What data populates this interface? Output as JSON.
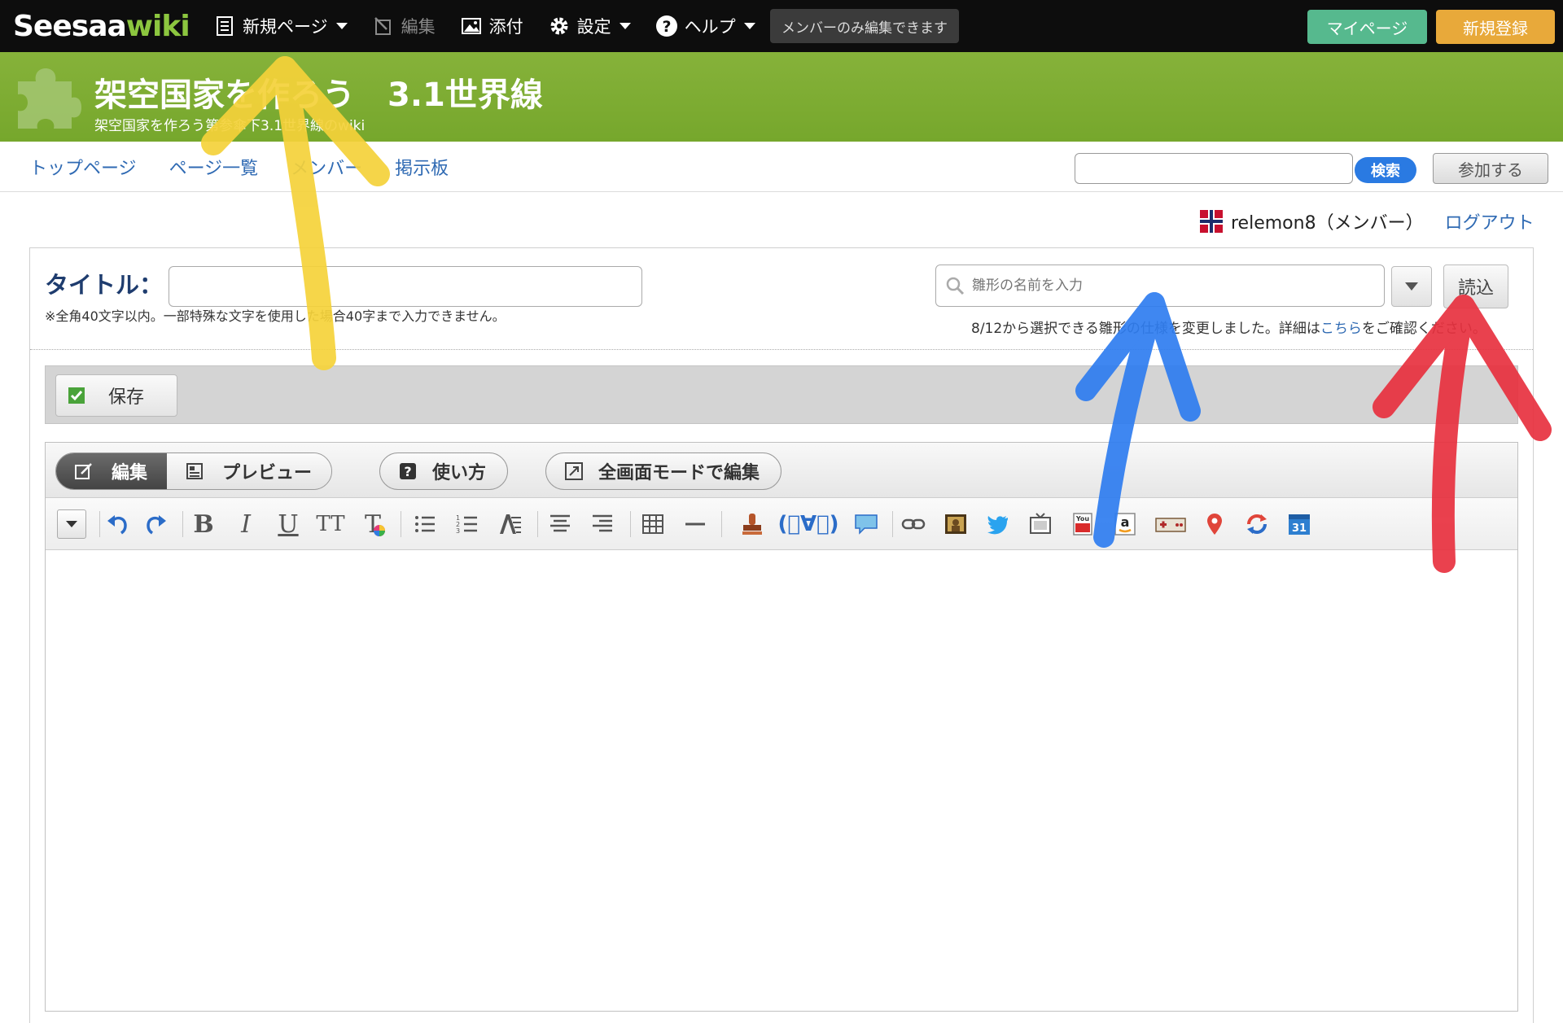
{
  "topbar": {
    "logo_a": "Seesaa",
    "logo_b": "wiki",
    "new_page": "新規ページ",
    "edit": "編集",
    "attach": "添付",
    "settings": "設定",
    "help": "ヘルプ",
    "member_note": "メンバーのみ編集できます",
    "mypage": "マイページ",
    "register": "新規登録"
  },
  "header": {
    "title": "架空国家を作ろう　3.1世界線",
    "subtitle": "架空国家を作ろう第参傘下3.1世界線のwiki"
  },
  "subnav": {
    "links": [
      "トップページ",
      "ページ一覧",
      "メンバー",
      "掲示板"
    ],
    "search_value": "",
    "search_button": "検索",
    "join_button": "参加する"
  },
  "user": {
    "name": "relemon8（メンバー）",
    "logout": "ログアウト"
  },
  "editor": {
    "title_label": "タイトル：",
    "title_value": "",
    "title_note": "※全角40文字以内。一部特殊な文字を使用した場合40字まで入力できません。",
    "template_placeholder": "雛形の名前を入力",
    "load_button": "読込",
    "template_note_pre": "8/12から選択できる雛形の仕様を変更しました。詳細は",
    "template_note_link": "こちら",
    "template_note_post": "をご確認ください。",
    "save_button": "保存",
    "modes": {
      "edit": "編集",
      "preview": "プレビュー",
      "howto": "使い方",
      "fullscreen": "全画面モードで編集"
    },
    "toolbar": {
      "bold": "B",
      "italic": "I",
      "underline": "U",
      "font_size": "TT",
      "font_color": "T",
      "emoticon": "(ﾟ∀ﾟ)"
    },
    "body_value": ""
  },
  "colors": {
    "header_green": "#7aa932",
    "link_blue": "#2f6ab3",
    "mypage_green": "#56b98e",
    "register_orange": "#e8a93a",
    "arrow_yellow": "#f5d23a",
    "arrow_blue": "#2f7df0",
    "arrow_red": "#e8313f"
  }
}
